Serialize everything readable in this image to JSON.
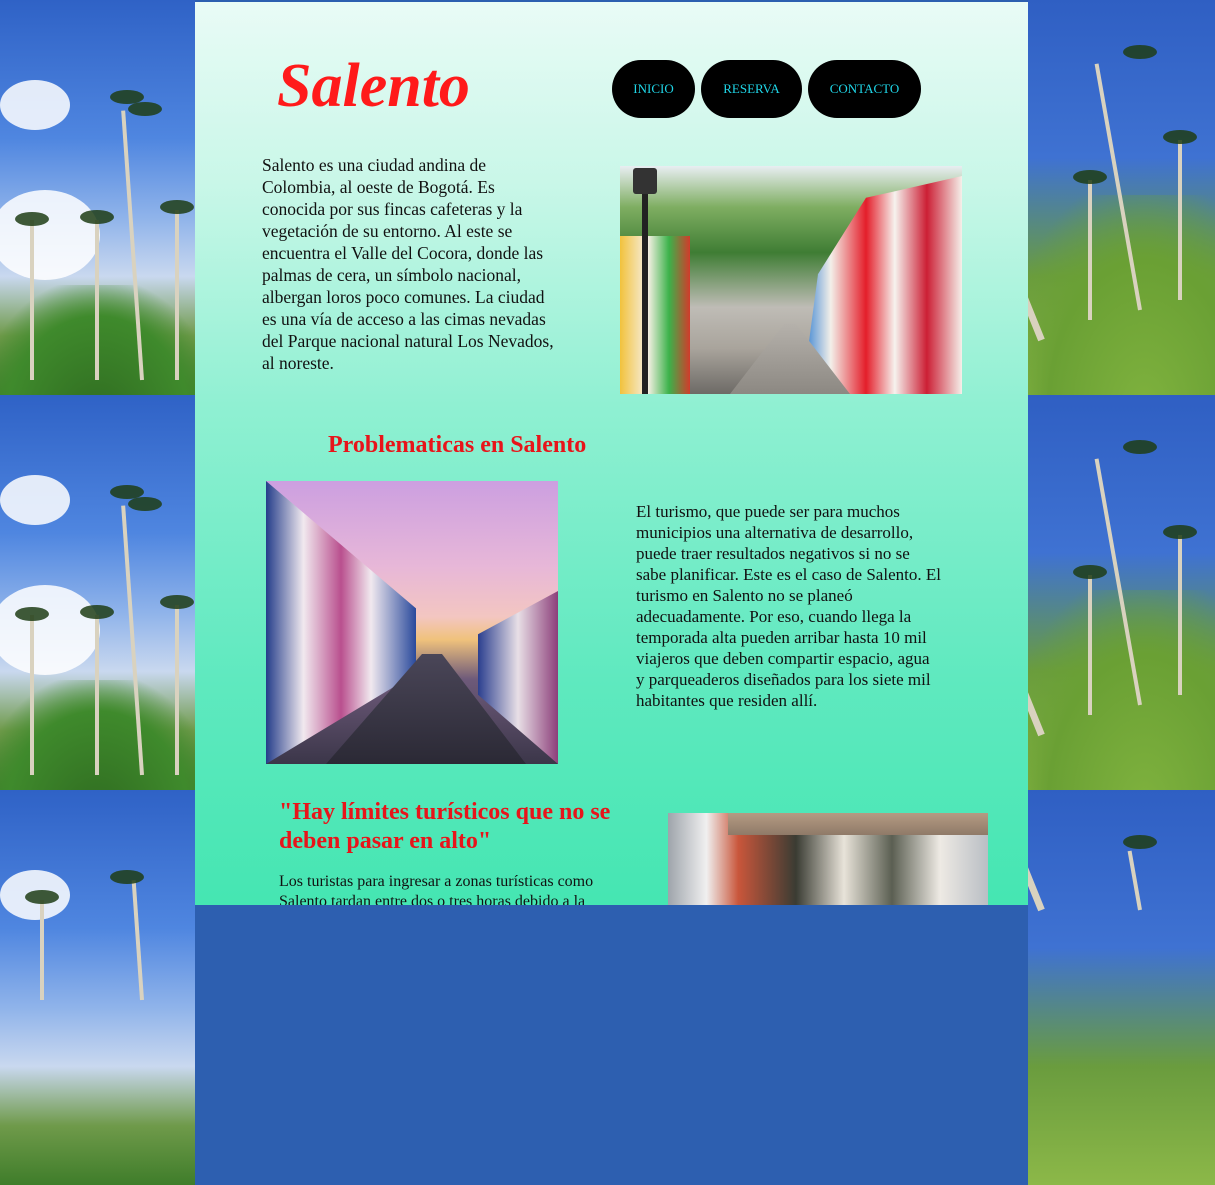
{
  "site": {
    "title": "Salento"
  },
  "nav": {
    "items": [
      {
        "label": "INICIO"
      },
      {
        "label": "RESERVA"
      },
      {
        "label": "CONTACTO"
      }
    ]
  },
  "intro": {
    "text": "Salento es una ciudad andina de Colombia, al oeste de Bogotá. Es conocida por sus fincas cafeteras y la vegetación de su entorno. Al este se encuentra el Valle del Cocora, donde las palmas de cera, un símbolo nacional, albergan loros poco comunes. La ciudad es una vía de acceso a las cimas nevadas del Parque nacional natural Los Nevados, al noreste."
  },
  "problems": {
    "heading": "Problematicas en Salento",
    "text": "El turismo, que puede ser para muchos municipios una alternativa de desarrollo, puede traer resultados negativos si no se sabe planificar. Este es el caso de Salento. El turismo en Salento no se planeó adecuadamente. Por eso, cuando llega la temporada alta pueden arribar hasta 10 mil viajeros que deben compartir espacio, agua y parqueaderos diseñados para los siete mil habitantes que residen allí."
  },
  "quote": {
    "heading": "\"Hay límites turísticos que no se deben pasar en alto\"",
    "text": "Los turistas para ingresar a zonas turísticas como Salento tardan entre dos o tres horas debido a la"
  },
  "images": {
    "street1": "salento-colorful-street-photo",
    "street2": "salento-sunset-street-photo",
    "street3": "salento-crowded-street-photo",
    "background": "cocora-wax-palms-background"
  },
  "colors": {
    "title": "#ff1a1a",
    "heading": "#e8141a",
    "nav_bg": "#000000",
    "nav_text": "#1fd6e8"
  }
}
